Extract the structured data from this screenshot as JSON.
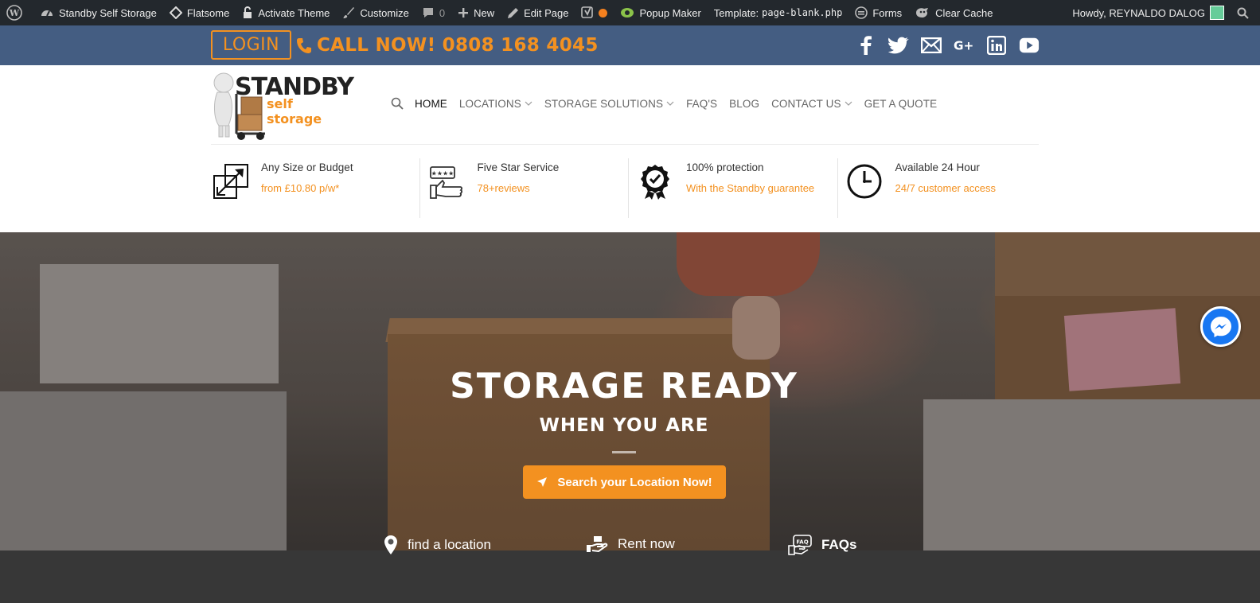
{
  "adminbar": {
    "site_name": "Standby Self Storage",
    "flatsome": "Flatsome",
    "activate_theme": "Activate Theme",
    "customize": "Customize",
    "comments_count": "0",
    "new": "New",
    "edit_page": "Edit Page",
    "popup_maker": "Popup Maker",
    "template_label": "Template:",
    "template_file": "page-blank.php",
    "forms": "Forms",
    "clear_cache": "Clear Cache",
    "howdy": "Howdy, REYNALDO DALOG"
  },
  "topbar": {
    "login_label": "LOGIN",
    "call_now": "CALL NOW! 0808 168 4045",
    "socials": [
      "facebook-icon",
      "twitter-icon",
      "envelope-icon",
      "google-plus-icon",
      "linkedin-icon",
      "youtube-icon"
    ]
  },
  "logo": {
    "title": "STANDBY",
    "subtitle": "self storage"
  },
  "nav": {
    "items": [
      {
        "label": "HOME",
        "active": true
      },
      {
        "label": "LOCATIONS",
        "dropdown": true
      },
      {
        "label": "STORAGE SOLUTIONS",
        "dropdown": true
      },
      {
        "label": "FAQ'S"
      },
      {
        "label": "BLOG"
      },
      {
        "label": "CONTACT US",
        "dropdown": true
      },
      {
        "label": "GET A QUOTE"
      }
    ]
  },
  "features": [
    {
      "title": "Any Size or Budget",
      "sub": "from  £10.80 p/w*",
      "icon": "resize-arrow-icon"
    },
    {
      "title": "Five Star Service",
      "sub": "78+reviews",
      "icon": "thumbs-up-rating-icon"
    },
    {
      "title": "100% protection",
      "sub": "With the Standby guarantee",
      "icon": "award-badge-icon"
    },
    {
      "title": "Available 24 Hour",
      "sub": "24/7 customer access",
      "icon": "clock-icon"
    }
  ],
  "hero": {
    "title": "STORAGE READY",
    "subtitle": "WHEN YOU ARE",
    "cta": "Search your Location Now!",
    "links": [
      "find a location",
      "Rent now",
      "FAQs"
    ]
  },
  "colors": {
    "accent": "#f39120",
    "topbar": "#445d82",
    "adminbar": "#23282d"
  }
}
